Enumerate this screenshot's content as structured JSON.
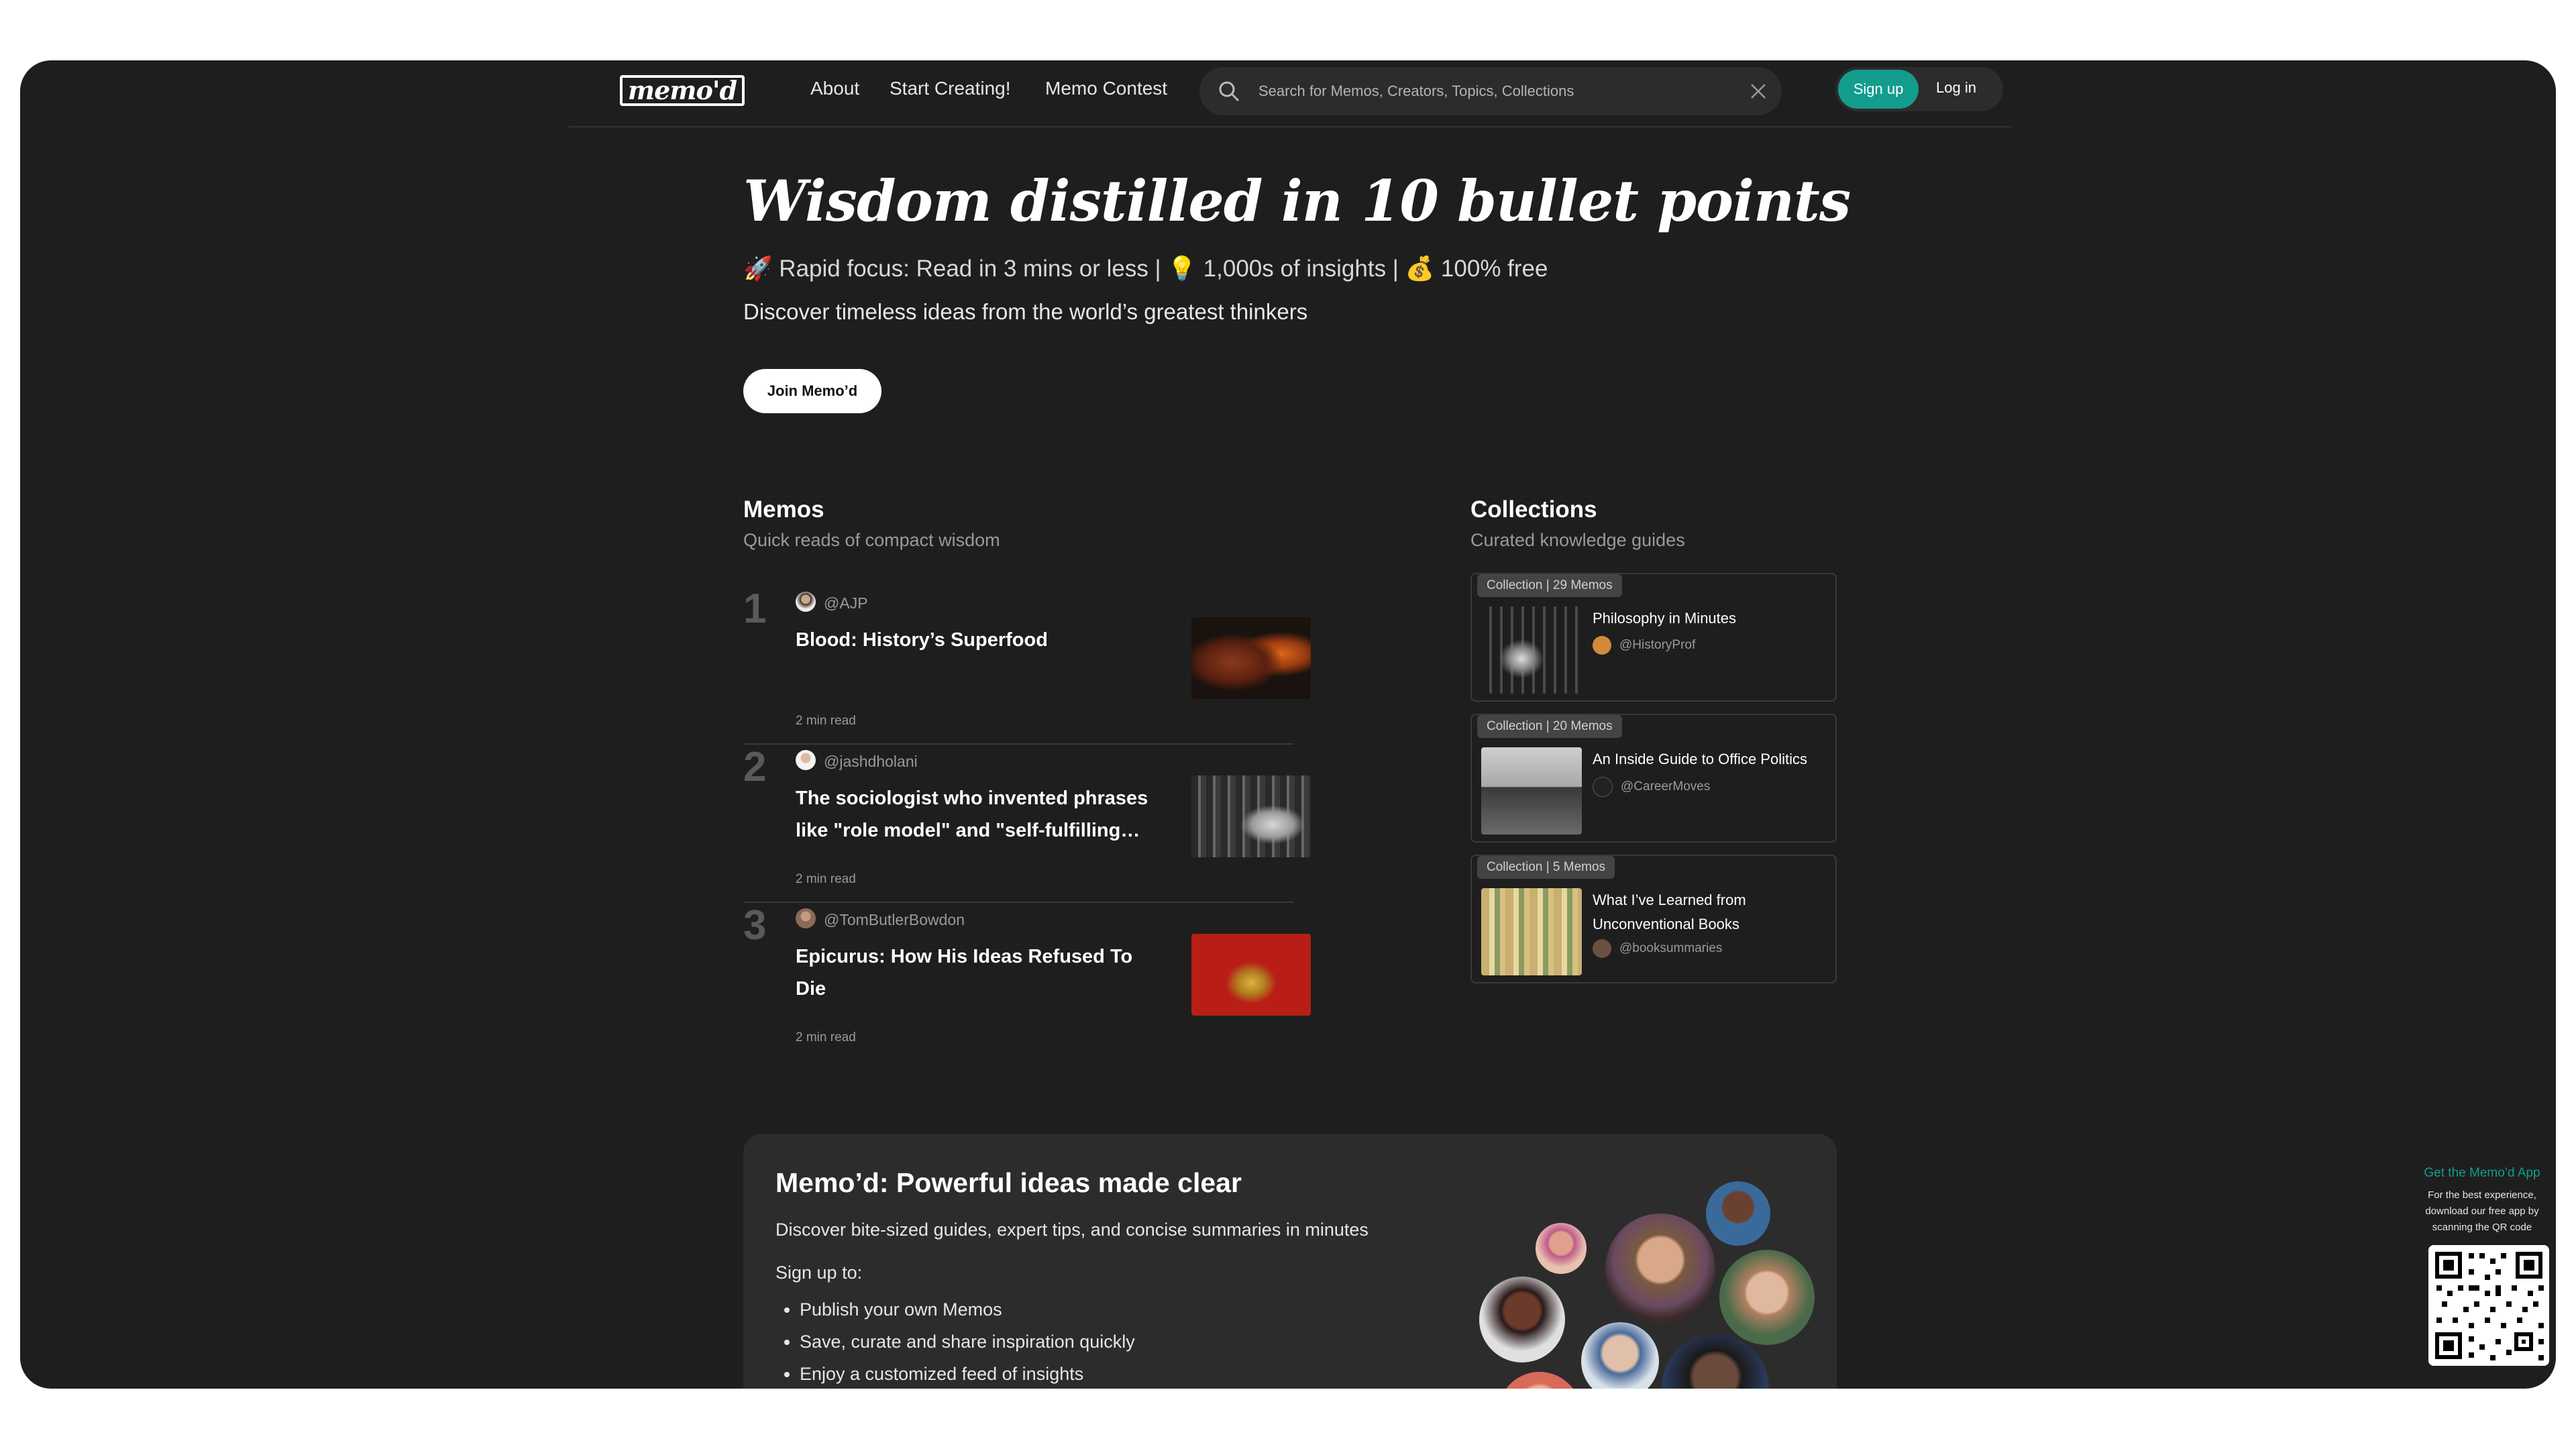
{
  "header": {
    "logo": "memo'd",
    "nav": [
      "About",
      "Start Creating!",
      "Memo Contest"
    ],
    "search_placeholder": "Search for Memos, Creators, Topics, Collections",
    "signup": "Sign up",
    "login": "Log in"
  },
  "hero": {
    "title": "Wisdom distilled in 10 bullet points",
    "subtitle": "🚀 Rapid focus: Read in 3 mins or less | 💡 1,000s of insights | 💰 100% free",
    "tagline": "Discover timeless ideas from the world’s greatest thinkers",
    "join_button": "Join Memo’d"
  },
  "memos": {
    "title": "Memos",
    "subtitle": "Quick reads of compact wisdom",
    "items": [
      {
        "num": "1",
        "author": "@AJP",
        "title": "Blood: History’s Superfood",
        "time": "2 min read"
      },
      {
        "num": "2",
        "author": "@jashdholani",
        "title": "The sociologist who invented phrases like \"role model\" and \"self-fulfilling…",
        "time": "2 min read"
      },
      {
        "num": "3",
        "author": "@TomButlerBowdon",
        "title": "Epicurus: How His Ideas Refused To Die",
        "time": "2 min read"
      }
    ]
  },
  "collections": {
    "title": "Collections",
    "subtitle": "Curated knowledge guides",
    "items": [
      {
        "badge": "Collection  |  29 Memos",
        "title": "Philosophy in Minutes",
        "author": "@HistoryProf"
      },
      {
        "badge": "Collection  |  20 Memos",
        "title": "An Inside Guide to Office Politics",
        "author": "@CareerMoves"
      },
      {
        "badge": "Collection  |  5 Memos",
        "title": "What I’ve Learned from Unconventional Books",
        "author": "@booksummaries"
      }
    ]
  },
  "promo": {
    "title": "Memo’d: Powerful ideas made clear",
    "subtitle": "Discover bite-sized guides, expert tips, and concise summaries in minutes",
    "signup_label": "Sign up to:",
    "bullets": [
      "Publish your own Memos",
      "Save, curate and share inspiration quickly",
      "Enjoy a customized feed of insights"
    ]
  },
  "app": {
    "title": "Get the Memo’d App",
    "description": "For the best experience, download our free app by scanning the QR code"
  },
  "colors": {
    "accent": "#129d8d",
    "background": "#1e1e1e",
    "card": "#2c2c2c"
  }
}
